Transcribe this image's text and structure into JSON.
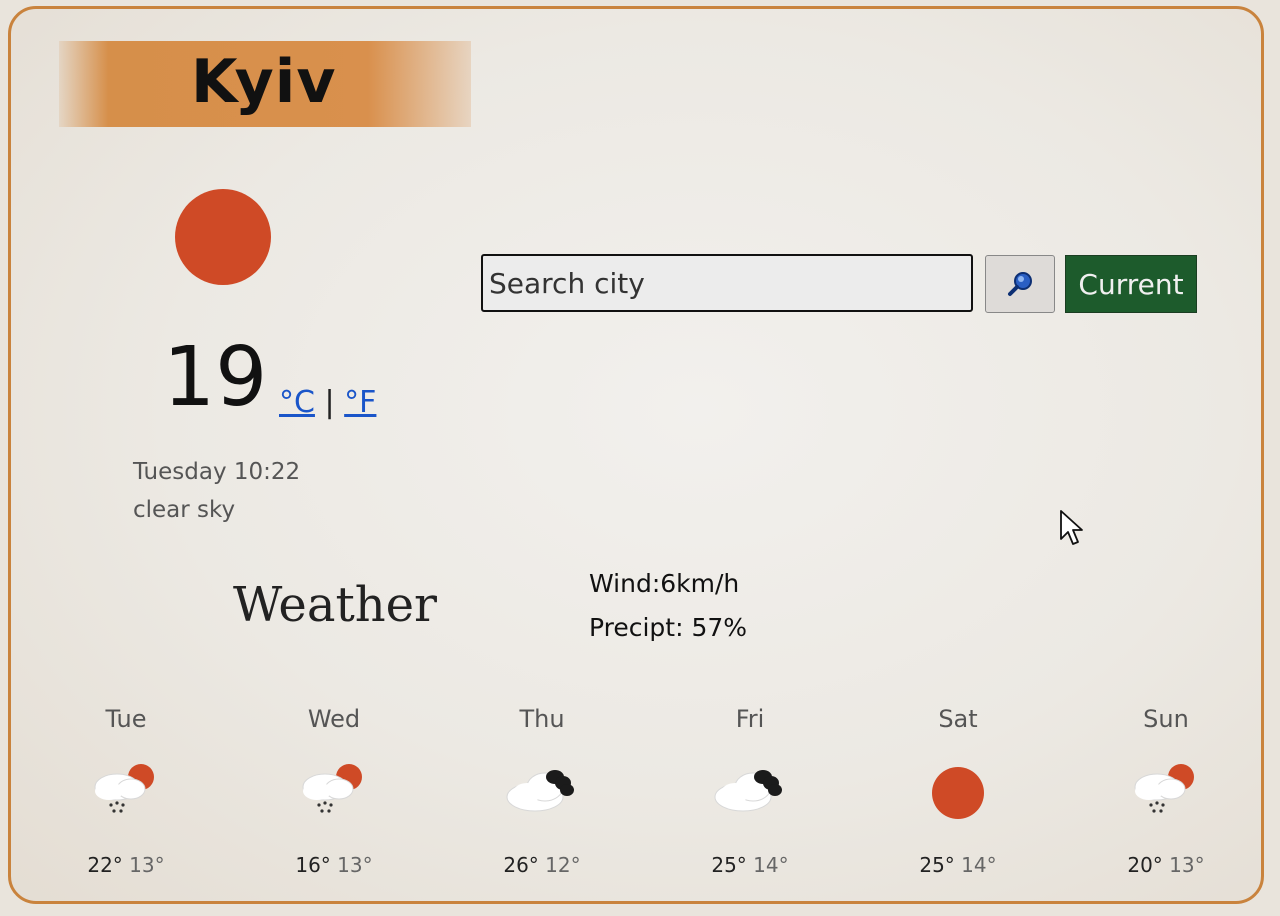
{
  "city": "Kyiv",
  "current": {
    "temperature": "19",
    "unit_c": "°C",
    "unit_sep": "|",
    "unit_f": "°F",
    "datetime": "Tuesday 10:22",
    "description": "clear sky",
    "icon": "sun-icon",
    "wind": "Wind:6km/h",
    "precip": "Precipt: 57%"
  },
  "search": {
    "placeholder": "Search city",
    "button_icon": "magnifier-icon",
    "current_label": "Current"
  },
  "section_label": "Weather",
  "forecast": [
    {
      "day": "Tue",
      "icon": "rain-sun-icon",
      "high": "22°",
      "low": "13°"
    },
    {
      "day": "Wed",
      "icon": "rain-sun-icon",
      "high": "16°",
      "low": "13°"
    },
    {
      "day": "Thu",
      "icon": "cloud-dark-cloud-icon",
      "high": "26°",
      "low": "12°"
    },
    {
      "day": "Fri",
      "icon": "cloud-dark-cloud-icon",
      "high": "25°",
      "low": "14°"
    },
    {
      "day": "Sat",
      "icon": "sun-icon",
      "high": "25°",
      "low": "14°"
    },
    {
      "day": "Sun",
      "icon": "rain-sun-icon",
      "high": "20°",
      "low": "13°"
    }
  ],
  "colors": {
    "border": "#c9833d",
    "title_band": "#d68f4a",
    "sun": "#cf4a26",
    "link": "#1a55c9",
    "current_button": "#1d5b2c"
  }
}
